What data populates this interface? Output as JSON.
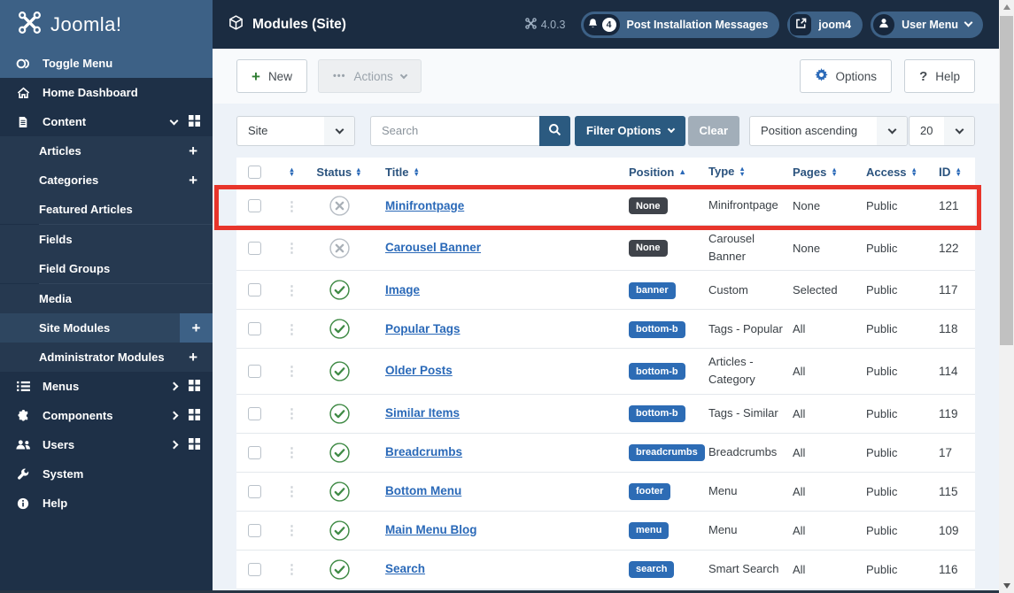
{
  "header": {
    "logo": "Joomla!",
    "page_title": "Modules (Site)",
    "version": "4.0.3",
    "post_installation_count": "4",
    "post_installation_label": "Post Installation Messages",
    "site_name": "joom4",
    "user_menu_label": "User Menu"
  },
  "sidebar": {
    "items": [
      {
        "label": "Toggle Menu"
      },
      {
        "label": "Home Dashboard"
      },
      {
        "label": "Content"
      },
      {
        "label": "Articles"
      },
      {
        "label": "Categories"
      },
      {
        "label": "Featured Articles"
      },
      {
        "label": "Fields"
      },
      {
        "label": "Field Groups"
      },
      {
        "label": "Media"
      },
      {
        "label": "Site Modules"
      },
      {
        "label": "Administrator Modules"
      },
      {
        "label": "Menus"
      },
      {
        "label": "Components"
      },
      {
        "label": "Users"
      },
      {
        "label": "System"
      },
      {
        "label": "Help"
      }
    ]
  },
  "toolbar": {
    "new_label": "New",
    "actions_label": "Actions",
    "options_label": "Options",
    "help_label": "Help"
  },
  "filters": {
    "client_select": "Site",
    "search_placeholder": "Search",
    "filter_options_label": "Filter Options",
    "clear_label": "Clear",
    "sort_select": "Position ascending",
    "limit_select": "20"
  },
  "table": {
    "columns": [
      "Status",
      "Title",
      "Position",
      "Type",
      "Pages",
      "Access",
      "ID"
    ],
    "rows": [
      {
        "title": "Minifrontpage",
        "status": "unpublished",
        "position": "None",
        "position_style": "dark",
        "type": "Minifrontpage",
        "pages": "None",
        "access": "Public",
        "id": "121"
      },
      {
        "title": "Carousel Banner",
        "status": "unpublished",
        "position": "None",
        "position_style": "dark",
        "type": "Carousel Banner",
        "pages": "None",
        "access": "Public",
        "id": "122"
      },
      {
        "title": "Image",
        "status": "published",
        "position": "banner",
        "position_style": "blue",
        "type": "Custom",
        "pages": "Selected",
        "access": "Public",
        "id": "117"
      },
      {
        "title": "Popular Tags",
        "status": "published",
        "position": "bottom-b",
        "position_style": "blue",
        "type": "Tags - Popular",
        "pages": "All",
        "access": "Public",
        "id": "118"
      },
      {
        "title": "Older Posts",
        "status": "published",
        "position": "bottom-b",
        "position_style": "blue",
        "type": "Articles - Category",
        "pages": "All",
        "access": "Public",
        "id": "114"
      },
      {
        "title": "Similar Items",
        "status": "published",
        "position": "bottom-b",
        "position_style": "blue",
        "type": "Tags - Similar",
        "pages": "All",
        "access": "Public",
        "id": "119"
      },
      {
        "title": "Breadcrumbs",
        "status": "published",
        "position": "breadcrumbs",
        "position_style": "blue",
        "type": "Breadcrumbs",
        "pages": "All",
        "access": "Public",
        "id": "17"
      },
      {
        "title": "Bottom Menu",
        "status": "published",
        "position": "footer",
        "position_style": "blue",
        "type": "Menu",
        "pages": "All",
        "access": "Public",
        "id": "115"
      },
      {
        "title": "Main Menu Blog",
        "status": "published",
        "position": "menu",
        "position_style": "blue",
        "type": "Menu",
        "pages": "All",
        "access": "Public",
        "id": "109"
      },
      {
        "title": "Search",
        "status": "published",
        "position": "search",
        "position_style": "blue",
        "type": "Smart Search",
        "pages": "All",
        "access": "Public",
        "id": "116"
      }
    ]
  },
  "colors": {
    "header_bg": "#1b2c41",
    "logo_bg": "#3d6186",
    "sidebar_bg": "#1e3047",
    "badge_blue": "#2d6cb5",
    "badge_dark": "#3f434a",
    "link_blue": "#2a69b8",
    "published_green": "#3f8a45",
    "annotation_red": "#e8352b"
  }
}
